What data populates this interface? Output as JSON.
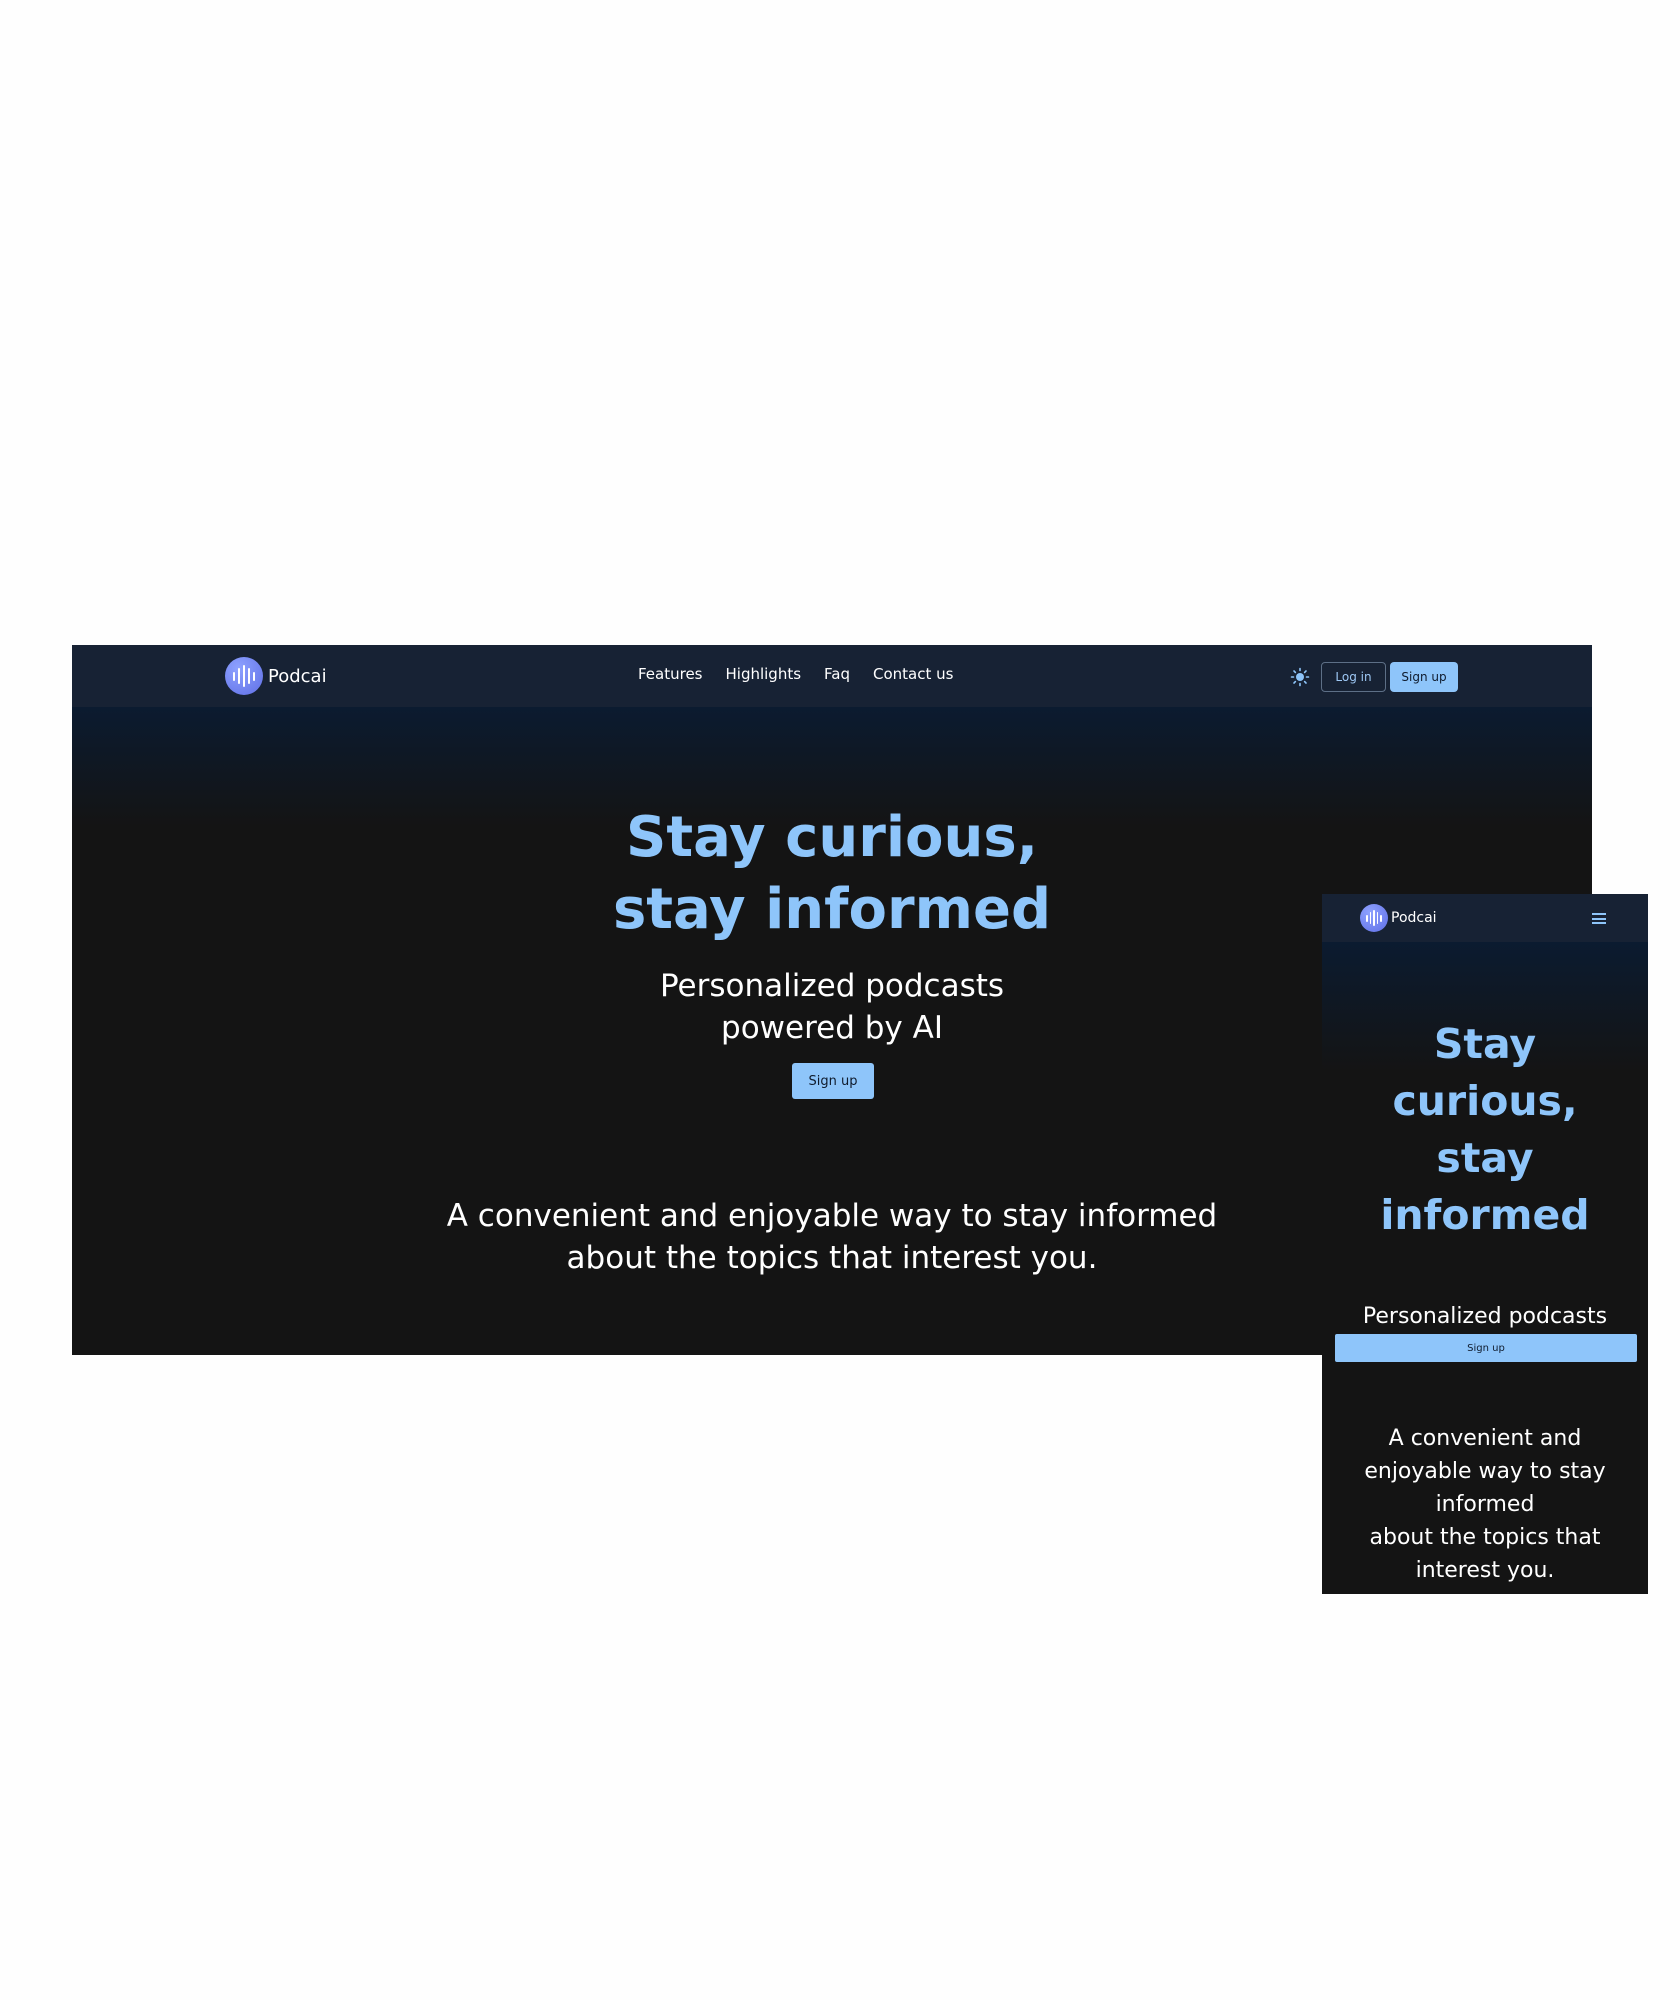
{
  "brand": {
    "name": "Podcai",
    "logo_icon": "soundwave-logo-icon"
  },
  "colors": {
    "accent": "#8ec5fa",
    "background": "#141414",
    "nav_background": "#172234",
    "logo": "#6f7ff0"
  },
  "desktop": {
    "nav": {
      "links": [
        "Features",
        "Highlights",
        "Faq",
        "Contact us"
      ],
      "theme_icon": "sun-icon",
      "login_label": "Log in",
      "signup_label": "Sign up"
    },
    "hero": {
      "title": "Stay curious,\nstay informed",
      "subtitle": "Personalized podcasts\npowered by AI",
      "cta_label": "Sign up",
      "tagline": "A convenient and enjoyable way to stay informed\nabout the topics that interest you."
    }
  },
  "mobile": {
    "nav": {
      "menu_icon": "hamburger-menu-icon"
    },
    "hero": {
      "title": "Stay\ncurious,\nstay\ninformed",
      "subtitle": "Personalized podcasts\npowered by AI",
      "cta_label": "Sign up",
      "tagline": "A convenient and\nenjoyable way to stay\ninformed\nabout the topics that\ninterest you."
    }
  }
}
